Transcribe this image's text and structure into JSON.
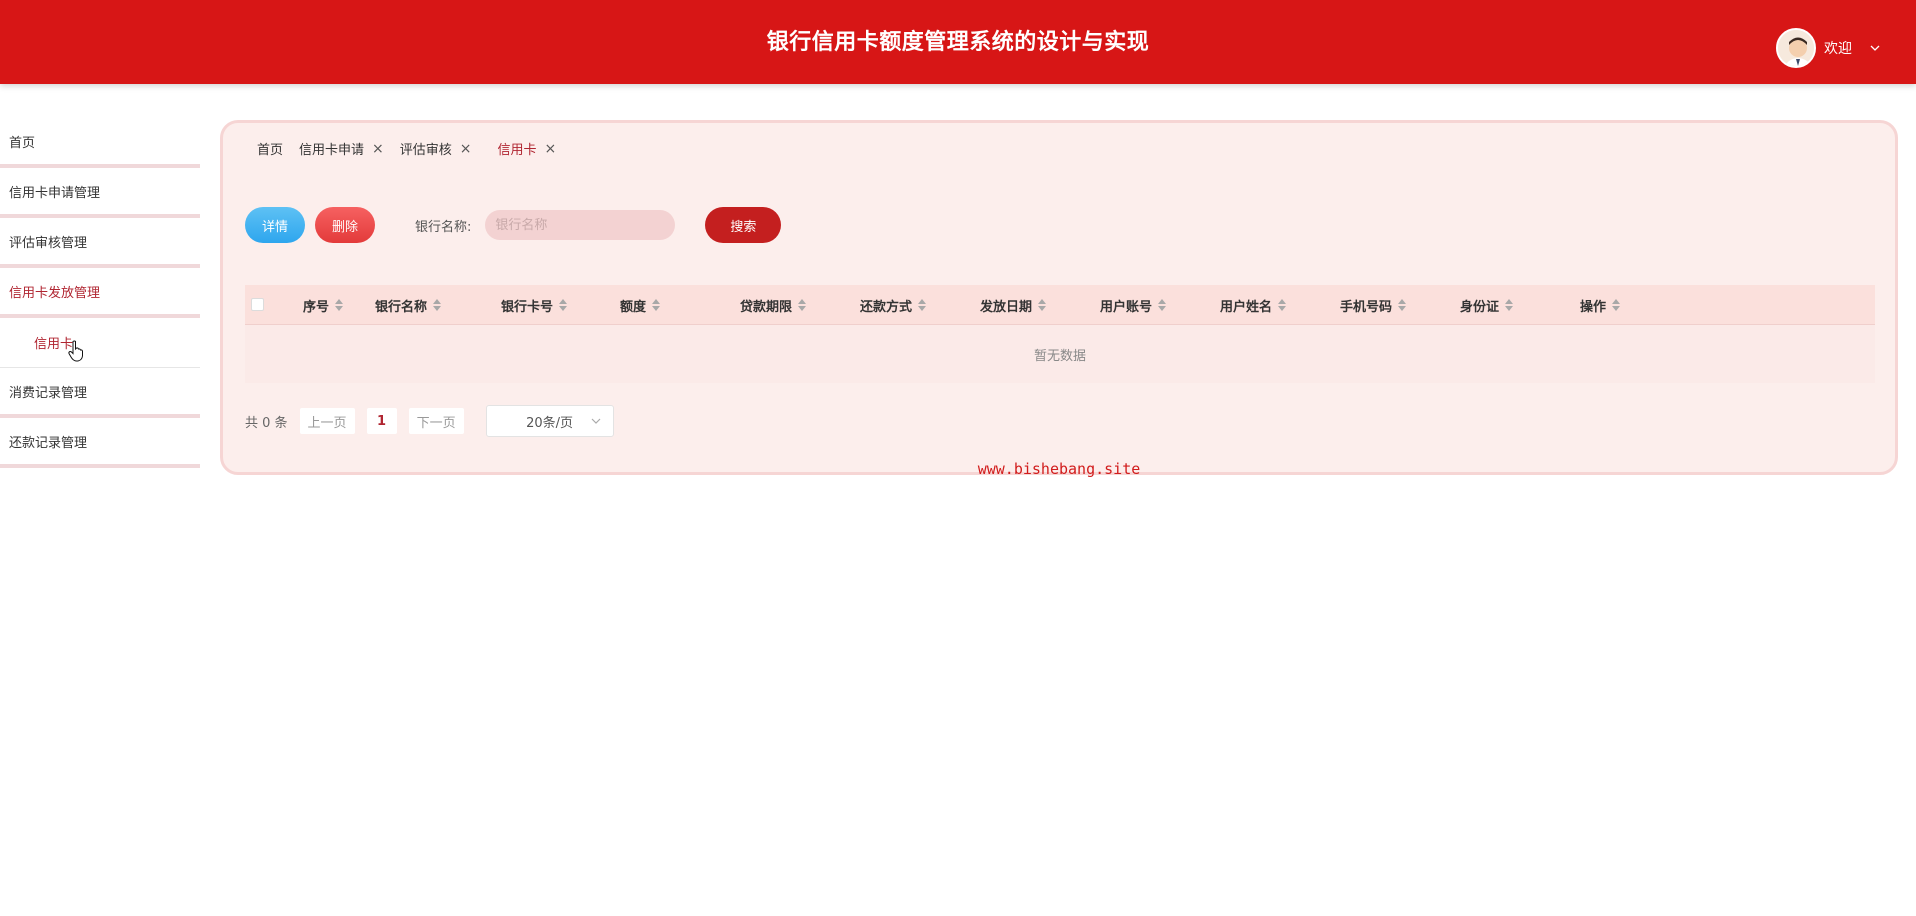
{
  "header": {
    "title": "银行信用卡额度管理系统的设计与实现",
    "welcome": "欢迎"
  },
  "sidebar": {
    "items": [
      {
        "label": "首页"
      },
      {
        "label": "信用卡申请管理"
      },
      {
        "label": "评估审核管理"
      },
      {
        "label": "信用卡发放管理"
      },
      {
        "label": "信用卡"
      },
      {
        "label": "消费记录管理"
      },
      {
        "label": "还款记录管理"
      }
    ]
  },
  "tabs": [
    {
      "label": "首页"
    },
    {
      "label": "信用卡申请"
    },
    {
      "label": "评估审核"
    },
    {
      "label": "信用卡"
    }
  ],
  "toolbar": {
    "detail_label": "详情",
    "delete_label": "删除",
    "search_label": "银行名称:",
    "search_placeholder": "银行名称",
    "search_button": "搜索"
  },
  "table": {
    "columns": [
      "序号",
      "银行名称",
      "银行卡号",
      "额度",
      "贷款期限",
      "还款方式",
      "发放日期",
      "用户账号",
      "用户姓名",
      "手机号码",
      "身份证",
      "操作"
    ],
    "empty_text": "暂无数据"
  },
  "pagination": {
    "total": "共 0 条",
    "prev": "上一页",
    "page": "1",
    "next": "下一页",
    "page_size": "20条/页"
  },
  "watermark": "www.bishebang.site",
  "colors": {
    "header_bg": "#d71616",
    "accent": "#b02531",
    "detail_button": "#2ea6ee",
    "delete_button": "#e33a3a",
    "search_button": "#c41f1f"
  }
}
